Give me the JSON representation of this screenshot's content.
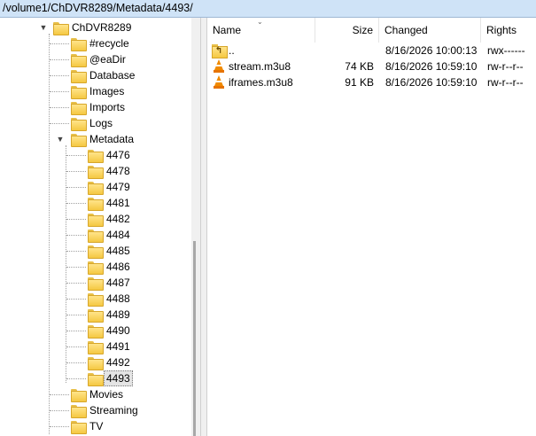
{
  "path": "/volume1/ChDVR8289/Metadata/4493/",
  "tree": {
    "root": "ChDVR8289",
    "items": [
      {
        "label": "#recycle"
      },
      {
        "label": "@eaDir"
      },
      {
        "label": "Database"
      },
      {
        "label": "Images"
      },
      {
        "label": "Imports"
      },
      {
        "label": "Logs"
      },
      {
        "label": "Metadata"
      },
      {
        "label": "4476"
      },
      {
        "label": "4478"
      },
      {
        "label": "4479"
      },
      {
        "label": "4481"
      },
      {
        "label": "4482"
      },
      {
        "label": "4484"
      },
      {
        "label": "4485"
      },
      {
        "label": "4486"
      },
      {
        "label": "4487"
      },
      {
        "label": "4488"
      },
      {
        "label": "4489"
      },
      {
        "label": "4490"
      },
      {
        "label": "4491"
      },
      {
        "label": "4492"
      },
      {
        "label": "4493"
      },
      {
        "label": "Movies"
      },
      {
        "label": "Streaming"
      },
      {
        "label": "TV"
      }
    ]
  },
  "list": {
    "columns": {
      "name": "Name",
      "size": "Size",
      "changed": "Changed",
      "rights": "Rights"
    },
    "rows": [
      {
        "name": "..",
        "size": "",
        "changed": "8/16/2026 10:00:13",
        "rights": "rwx------",
        "icon": "parent-folder-icon"
      },
      {
        "name": "stream.m3u8",
        "size": "74 KB",
        "changed": "8/16/2026 10:59:10",
        "rights": "rw-r--r--",
        "icon": "vlc-icon"
      },
      {
        "name": "iframes.m3u8",
        "size": "91 KB",
        "changed": "8/16/2026 10:59:10",
        "rights": "rw-r--r--",
        "icon": "vlc-icon"
      }
    ]
  }
}
